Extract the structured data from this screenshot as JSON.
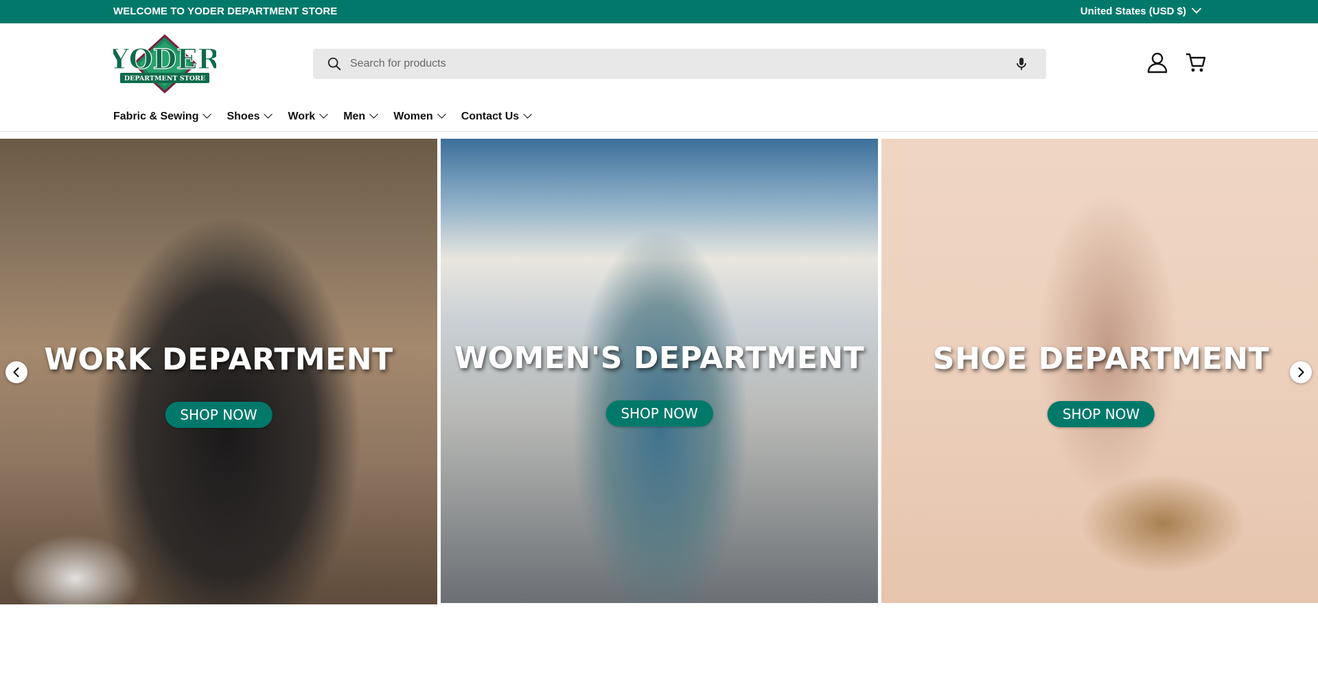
{
  "announcement": {
    "welcome_text": "WELCOME TO YODER DEPARTMENT STORE",
    "country_selector": "United States (USD $)"
  },
  "header": {
    "logo": {
      "main_text": "YODER",
      "sub_text": "DEPARTMENT STORE"
    },
    "search": {
      "placeholder": "Search for products",
      "value": ""
    },
    "nav": [
      {
        "label": "Fabric & Sewing"
      },
      {
        "label": "Shoes"
      },
      {
        "label": "Work"
      },
      {
        "label": "Men"
      },
      {
        "label": "Women"
      },
      {
        "label": "Contact Us"
      }
    ],
    "icons": [
      "search-icon",
      "microphone-icon",
      "account-icon",
      "cart-icon"
    ]
  },
  "carousel": {
    "slides": [
      {
        "title": "WORK DEPARTMENT",
        "cta": "SHOP NOW"
      },
      {
        "title": "WOMEN'S DEPARTMENT",
        "cta": "SHOP NOW"
      },
      {
        "title": "SHOE DEPARTMENT",
        "cta": "SHOP NOW"
      }
    ],
    "prev_icon": "chevron-left-icon",
    "next_icon": "chevron-right-icon"
  },
  "colors": {
    "brand": "#00796b",
    "announcement_bg": "#00796b",
    "search_bg": "#e8e8e8",
    "text": "#111111"
  }
}
